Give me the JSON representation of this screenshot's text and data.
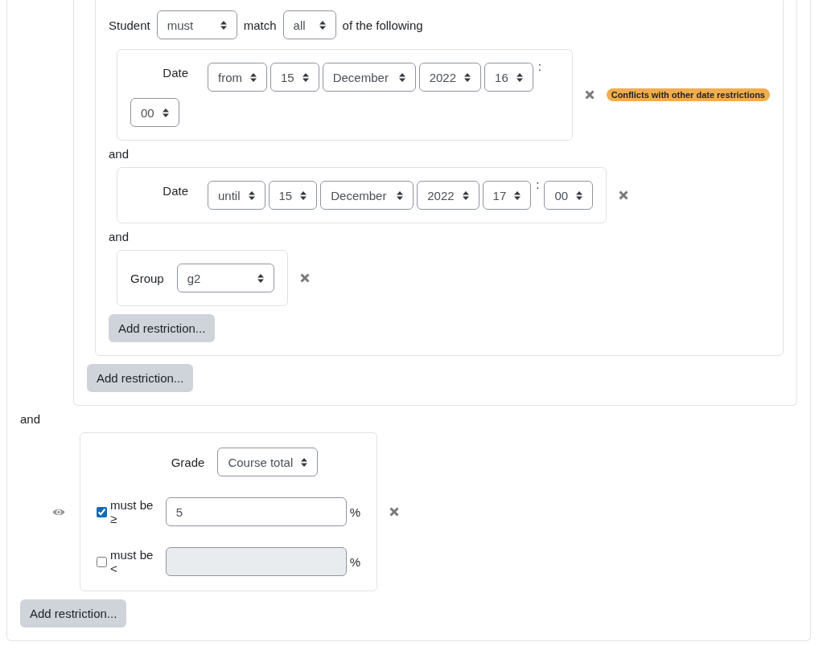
{
  "restrictions": {
    "items": [
      {
        "kind": "set",
        "items": [
          {
            "kind": "set",
            "header": {
              "label_1": "Student",
              "must": "must",
              "match": "match",
              "all": "all",
              "label_2": "of the following"
            },
            "items": [
              {
                "kind": "date",
                "label": "Date",
                "direction": "from",
                "day": "15",
                "month": "December",
                "year": "2022",
                "hour": "16",
                "separator": ":",
                "minute": "00",
                "warning": "Conflicts with other date restrictions"
              },
              {
                "kind": "date",
                "connector": "and",
                "label": "Date",
                "direction": "until",
                "day": "15",
                "month": "December",
                "year": "2022",
                "hour": "17",
                "separator": ":",
                "minute": "00"
              },
              {
                "kind": "group",
                "connector": "and",
                "label": "Group",
                "group": "g2"
              }
            ],
            "add_button": "Add restriction..."
          }
        ],
        "add_button": "Add restriction..."
      },
      {
        "kind": "grade",
        "connector": "and",
        "label": "Grade",
        "item": "Course total",
        "conditions": [
          {
            "checked": true,
            "label": "must be ≥",
            "value": "5",
            "unit": "%"
          },
          {
            "checked": false,
            "label": "must be <",
            "unit": "%"
          }
        ]
      }
    ],
    "add_button": "Add restriction..."
  }
}
